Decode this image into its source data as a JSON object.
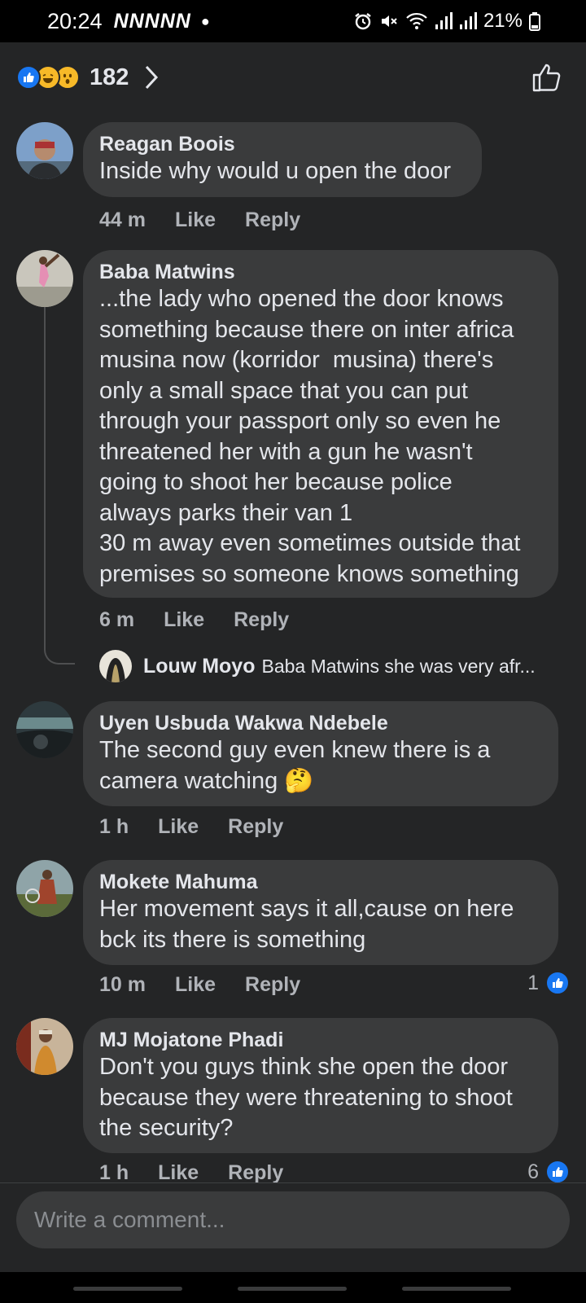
{
  "status_bar": {
    "time": "20:24",
    "notifications": "NNNNN",
    "battery": "21%"
  },
  "header": {
    "reactions": [
      "like",
      "haha",
      "wow"
    ],
    "reaction_count": "182"
  },
  "comments": [
    {
      "author": "Reagan Boois",
      "text": "Inside why would u open the door",
      "time": "44 m",
      "like_label": "Like",
      "reply_label": "Reply"
    },
    {
      "author": "Baba Matwins",
      "text": "...the lady who opened the door knows\nsomething because there on inter africa\nmusina now (korridor  musina) there's\nonly a small space that you can put\nthrough your passport only so even he\nthreatened her with a gun he wasn't\ngoing to shoot her because police\nalways parks their van 1\n30 m away even sometimes outside that\npremises so someone knows something",
      "time": "6 m",
      "like_label": "Like",
      "reply_label": "Reply",
      "reply_preview": {
        "author": "Louw Moyo",
        "text": "Baba Matwins she was very afr..."
      }
    },
    {
      "author": "Uyen Usbuda Wakwa Ndebele",
      "text": "The second guy even knew there is a\ncamera watching 🤔",
      "time": "1 h",
      "like_label": "Like",
      "reply_label": "Reply"
    },
    {
      "author": "Mokete Mahuma",
      "text": "Her movement says it all,cause on here\nbck its there is something",
      "time": "10 m",
      "like_label": "Like",
      "reply_label": "Reply",
      "likes": "1"
    },
    {
      "author": "MJ Mojatone Phadi",
      "text": "Don't you guys think she open the door\nbecause they were threatening to shoot\nthe security?",
      "time": "1 h",
      "like_label": "Like",
      "reply_label": "Reply",
      "likes": "6"
    }
  ],
  "composer": {
    "placeholder": "Write a comment..."
  },
  "colors": {
    "background": "#242526",
    "bubble": "#3a3b3c",
    "accent": "#1877f2",
    "secondary_text": "#b0b3b8"
  }
}
